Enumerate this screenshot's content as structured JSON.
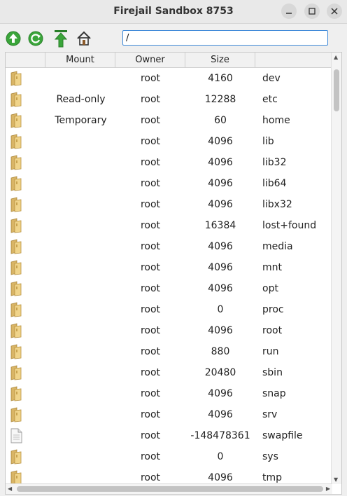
{
  "window": {
    "title": "Firejail Sandbox 8753",
    "minimize_icon": "minimize-icon",
    "maximize_icon": "maximize-icon",
    "close_icon": "close-icon"
  },
  "toolbar": {
    "buttons": [
      "up-circle-icon",
      "refresh-icon",
      "go-top-icon",
      "home-icon"
    ],
    "path_value": "/"
  },
  "table": {
    "headers": [
      "",
      "Mount",
      "Owner",
      "Size",
      ""
    ],
    "rows": [
      {
        "icon": "folder-icon",
        "mount": "",
        "owner": "root",
        "size": "4160",
        "name": "dev"
      },
      {
        "icon": "folder-icon",
        "mount": "Read-only",
        "owner": "root",
        "size": "12288",
        "name": "etc"
      },
      {
        "icon": "folder-icon",
        "mount": "Temporary",
        "owner": "root",
        "size": "60",
        "name": "home"
      },
      {
        "icon": "folder-icon",
        "mount": "",
        "owner": "root",
        "size": "4096",
        "name": "lib"
      },
      {
        "icon": "folder-icon",
        "mount": "",
        "owner": "root",
        "size": "4096",
        "name": "lib32"
      },
      {
        "icon": "folder-icon",
        "mount": "",
        "owner": "root",
        "size": "4096",
        "name": "lib64"
      },
      {
        "icon": "folder-icon",
        "mount": "",
        "owner": "root",
        "size": "4096",
        "name": "libx32"
      },
      {
        "icon": "folder-icon",
        "mount": "",
        "owner": "root",
        "size": "16384",
        "name": "lost+found"
      },
      {
        "icon": "folder-icon",
        "mount": "",
        "owner": "root",
        "size": "4096",
        "name": "media"
      },
      {
        "icon": "folder-icon",
        "mount": "",
        "owner": "root",
        "size": "4096",
        "name": "mnt"
      },
      {
        "icon": "folder-icon",
        "mount": "",
        "owner": "root",
        "size": "4096",
        "name": "opt"
      },
      {
        "icon": "folder-icon",
        "mount": "",
        "owner": "root",
        "size": "0",
        "name": "proc"
      },
      {
        "icon": "folder-icon",
        "mount": "",
        "owner": "root",
        "size": "4096",
        "name": "root"
      },
      {
        "icon": "folder-icon",
        "mount": "",
        "owner": "root",
        "size": "880",
        "name": "run"
      },
      {
        "icon": "folder-icon",
        "mount": "",
        "owner": "root",
        "size": "20480",
        "name": "sbin"
      },
      {
        "icon": "folder-icon",
        "mount": "",
        "owner": "root",
        "size": "4096",
        "name": "snap"
      },
      {
        "icon": "folder-icon",
        "mount": "",
        "owner": "root",
        "size": "4096",
        "name": "srv"
      },
      {
        "icon": "file-icon",
        "mount": "",
        "owner": "root",
        "size": "-148478361",
        "name": "swapfile"
      },
      {
        "icon": "folder-icon",
        "mount": "",
        "owner": "root",
        "size": "0",
        "name": "sys"
      },
      {
        "icon": "folder-icon",
        "mount": "",
        "owner": "root",
        "size": "4096",
        "name": "tmp"
      }
    ]
  },
  "colors": {
    "accent": "#3b87d8",
    "toolbar_green": "#3aa53a",
    "folder": "#e8c878"
  }
}
